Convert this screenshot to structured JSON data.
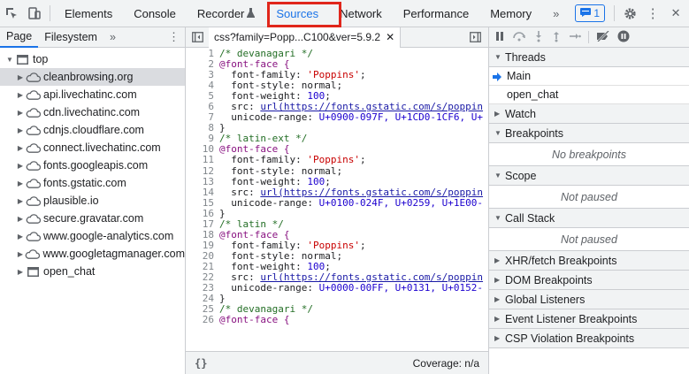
{
  "topbar": {
    "tabs": [
      {
        "label": "Elements"
      },
      {
        "label": "Console"
      },
      {
        "label": "Recorder"
      },
      {
        "label": "Sources"
      },
      {
        "label": "Network"
      },
      {
        "label": "Performance"
      },
      {
        "label": "Memory"
      }
    ],
    "more": "»",
    "issues_count": "1",
    "menu": "⋮",
    "close": "✕"
  },
  "navigator": {
    "tabs": [
      "Page",
      "Filesystem"
    ],
    "more": "»",
    "menu": "⋮",
    "root": "top",
    "items": [
      "cleanbrowsing.org",
      "api.livechatinc.com",
      "cdn.livechatinc.com",
      "cdnjs.cloudflare.com",
      "connect.livechatinc.com",
      "fonts.googleapis.com",
      "fonts.gstatic.com",
      "plausible.io",
      "secure.gravatar.com",
      "www.google-analytics.com",
      "www.googletagmanager.com",
      "open_chat"
    ]
  },
  "editor": {
    "file_tab": "css?family=Popp...C100&ver=5.9.2",
    "footer_format": "{}",
    "coverage": "Coverage: n/a",
    "lines": [
      {
        "n": "1",
        "t": "comment",
        "s": "/* devanagari */"
      },
      {
        "n": "2",
        "t": "at",
        "s": "@font-face {"
      },
      {
        "n": "3",
        "t": "prop",
        "k": "  font-family: ",
        "v": "'Poppins'",
        "vt": "str",
        "e": ";"
      },
      {
        "n": "4",
        "t": "prop",
        "k": "  font-style: ",
        "v": "normal",
        "vt": "plain",
        "e": ";"
      },
      {
        "n": "5",
        "t": "prop",
        "k": "  font-weight: ",
        "v": "100",
        "vt": "num",
        "e": ";"
      },
      {
        "n": "6",
        "t": "prop",
        "k": "  src: ",
        "v": "url(https://fonts.gstatic.com/s/poppin",
        "vt": "url",
        "e": ""
      },
      {
        "n": "7",
        "t": "prop",
        "k": "  unicode-range: ",
        "v": "U+0900-097F, U+1CD0-1CF6, U+",
        "vt": "num",
        "e": ""
      },
      {
        "n": "8",
        "t": "plain",
        "s": "}"
      },
      {
        "n": "9",
        "t": "comment",
        "s": "/* latin-ext */"
      },
      {
        "n": "10",
        "t": "at",
        "s": "@font-face {"
      },
      {
        "n": "11",
        "t": "prop",
        "k": "  font-family: ",
        "v": "'Poppins'",
        "vt": "str",
        "e": ";"
      },
      {
        "n": "12",
        "t": "prop",
        "k": "  font-style: ",
        "v": "normal",
        "vt": "plain",
        "e": ";"
      },
      {
        "n": "13",
        "t": "prop",
        "k": "  font-weight: ",
        "v": "100",
        "vt": "num",
        "e": ";"
      },
      {
        "n": "14",
        "t": "prop",
        "k": "  src: ",
        "v": "url(https://fonts.gstatic.com/s/poppin",
        "vt": "url",
        "e": ""
      },
      {
        "n": "15",
        "t": "prop",
        "k": "  unicode-range: ",
        "v": "U+0100-024F, U+0259, U+1E00-",
        "vt": "num",
        "e": ""
      },
      {
        "n": "16",
        "t": "plain",
        "s": "}"
      },
      {
        "n": "17",
        "t": "comment",
        "s": "/* latin */"
      },
      {
        "n": "18",
        "t": "at",
        "s": "@font-face {"
      },
      {
        "n": "19",
        "t": "prop",
        "k": "  font-family: ",
        "v": "'Poppins'",
        "vt": "str",
        "e": ";"
      },
      {
        "n": "20",
        "t": "prop",
        "k": "  font-style: ",
        "v": "normal",
        "vt": "plain",
        "e": ";"
      },
      {
        "n": "21",
        "t": "prop",
        "k": "  font-weight: ",
        "v": "100",
        "vt": "num",
        "e": ";"
      },
      {
        "n": "22",
        "t": "prop",
        "k": "  src: ",
        "v": "url(https://fonts.gstatic.com/s/poppin",
        "vt": "url",
        "e": ""
      },
      {
        "n": "23",
        "t": "prop",
        "k": "  unicode-range: ",
        "v": "U+0000-00FF, U+0131, U+0152-",
        "vt": "num",
        "e": ""
      },
      {
        "n": "24",
        "t": "plain",
        "s": "}"
      },
      {
        "n": "25",
        "t": "comment",
        "s": "/* devanagari */"
      },
      {
        "n": "26",
        "t": "at",
        "s": "@font-face {"
      }
    ]
  },
  "debugger": {
    "sections": [
      {
        "id": "threads",
        "label": "Threads",
        "open": true,
        "rows": [
          "Main",
          "open_chat"
        ]
      },
      {
        "id": "watch",
        "label": "Watch",
        "open": false
      },
      {
        "id": "breakpoints",
        "label": "Breakpoints",
        "open": true,
        "empty": "No breakpoints"
      },
      {
        "id": "scope",
        "label": "Scope",
        "open": true,
        "empty": "Not paused"
      },
      {
        "id": "call-stack",
        "label": "Call Stack",
        "open": true,
        "empty": "Not paused"
      },
      {
        "id": "xhr-fetch-breakpoints",
        "label": "XHR/fetch Breakpoints",
        "open": false
      },
      {
        "id": "dom-breakpoints",
        "label": "DOM Breakpoints",
        "open": false
      },
      {
        "id": "global-listeners",
        "label": "Global Listeners",
        "open": false
      },
      {
        "id": "event-listener-breakpoints",
        "label": "Event Listener Breakpoints",
        "open": false
      },
      {
        "id": "csp-violation-breakpoints",
        "label": "CSP Violation Breakpoints",
        "open": false
      }
    ]
  },
  "colors": {
    "accent": "#1a73e8",
    "highlight": "#e0261b"
  }
}
